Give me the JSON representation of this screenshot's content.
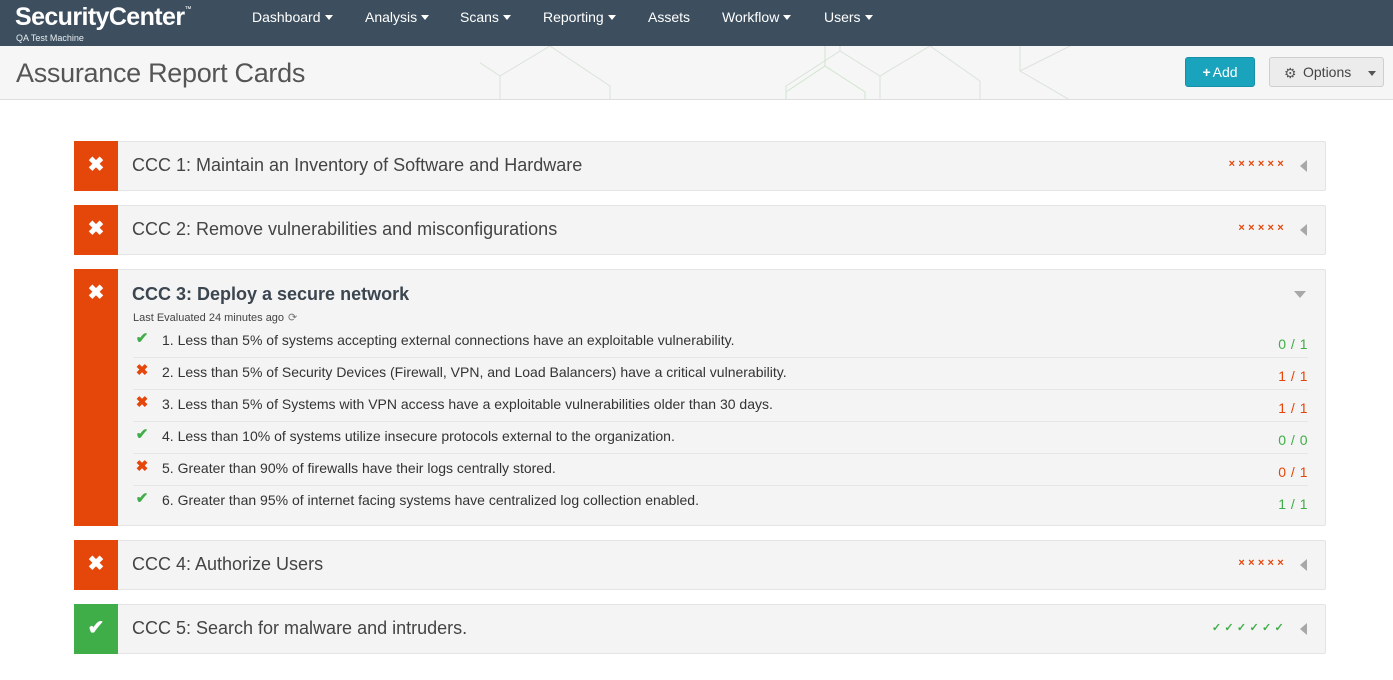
{
  "app": {
    "name": "SecurityCenter",
    "trademark": "™",
    "machine": "QA Test Machine"
  },
  "nav": {
    "items": [
      {
        "label": "Dashboard",
        "dropdown": true
      },
      {
        "label": "Analysis",
        "dropdown": true
      },
      {
        "label": "Scans",
        "dropdown": true
      },
      {
        "label": "Reporting",
        "dropdown": true
      },
      {
        "label": "Assets",
        "dropdown": false
      },
      {
        "label": "Workflow",
        "dropdown": true
      },
      {
        "label": "Users",
        "dropdown": true
      }
    ]
  },
  "header": {
    "title": "Assurance Report Cards",
    "add_label": "Add",
    "add_icon": "+",
    "options_label": "Options",
    "options_icon": "gear-icon"
  },
  "colors": {
    "nav_bg": "#3d4f5f",
    "fail": "#e5460a",
    "pass": "#3fae48",
    "add_button": "#1aa3bd"
  },
  "cards": [
    {
      "title": "CCC 1: Maintain an Inventory of Software and Hardware",
      "status": "fail",
      "status_icon": "✖",
      "summary": "××××××",
      "expanded": false
    },
    {
      "title": "CCC 2: Remove vulnerabilities and misconfigurations",
      "status": "fail",
      "status_icon": "✖",
      "summary": "×××××",
      "expanded": false
    },
    {
      "title": "CCC 3: Deploy a secure network",
      "status": "fail",
      "status_icon": "✖",
      "expanded": true,
      "last_evaluated": "Last Evaluated 24 minutes ago",
      "criteria": [
        {
          "icon": "✔",
          "status": "pass",
          "text": "1. Less than 5% of systems accepting external connections have an exploitable vulnerability.",
          "score": "0 / 1"
        },
        {
          "icon": "✖",
          "status": "fail",
          "text": "2. Less than 5% of Security Devices (Firewall, VPN, and Load Balancers) have a critical vulnerability.",
          "score": "1 / 1"
        },
        {
          "icon": "✖",
          "status": "fail",
          "text": "3. Less than 5% of Systems with VPN access have a exploitable vulnerabilities older than 30 days.",
          "score": "1 / 1"
        },
        {
          "icon": "✔",
          "status": "pass",
          "text": "4. Less than 10% of systems utilize insecure protocols external to the organization.",
          "score": "0 / 0"
        },
        {
          "icon": "✖",
          "status": "fail",
          "text": "5. Greater than 90% of firewalls have their logs centrally stored.",
          "score": "0 / 1"
        },
        {
          "icon": "✔",
          "status": "pass",
          "text": "6. Greater than 95% of internet facing systems have centralized log collection enabled.",
          "score": "1 / 1"
        }
      ]
    },
    {
      "title": "CCC 4: Authorize Users",
      "status": "fail",
      "status_icon": "✖",
      "summary": "×××××",
      "expanded": false
    },
    {
      "title": "CCC 5: Search for malware and intruders.",
      "status": "pass",
      "status_icon": "✔",
      "summary": "✓✓✓✓✓✓",
      "expanded": false
    }
  ]
}
